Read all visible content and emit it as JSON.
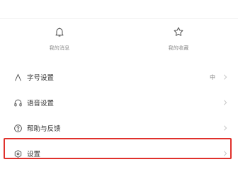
{
  "quick_actions": [
    {
      "label": "我的消息",
      "icon": "bell-icon"
    },
    {
      "label": "我的收藏",
      "icon": "star-icon"
    }
  ],
  "menu": [
    {
      "label": "字号设置",
      "icon": "font-size-icon",
      "value": "中"
    },
    {
      "label": "语音设置",
      "icon": "headphones-icon",
      "value": ""
    },
    {
      "label": "帮助与反馈",
      "icon": "help-icon",
      "value": ""
    },
    {
      "label": "设置",
      "icon": "settings-hex-icon",
      "value": ""
    }
  ],
  "colors": {
    "highlight": "#e0312c",
    "text": "#333333",
    "muted": "#8a8a8a"
  }
}
